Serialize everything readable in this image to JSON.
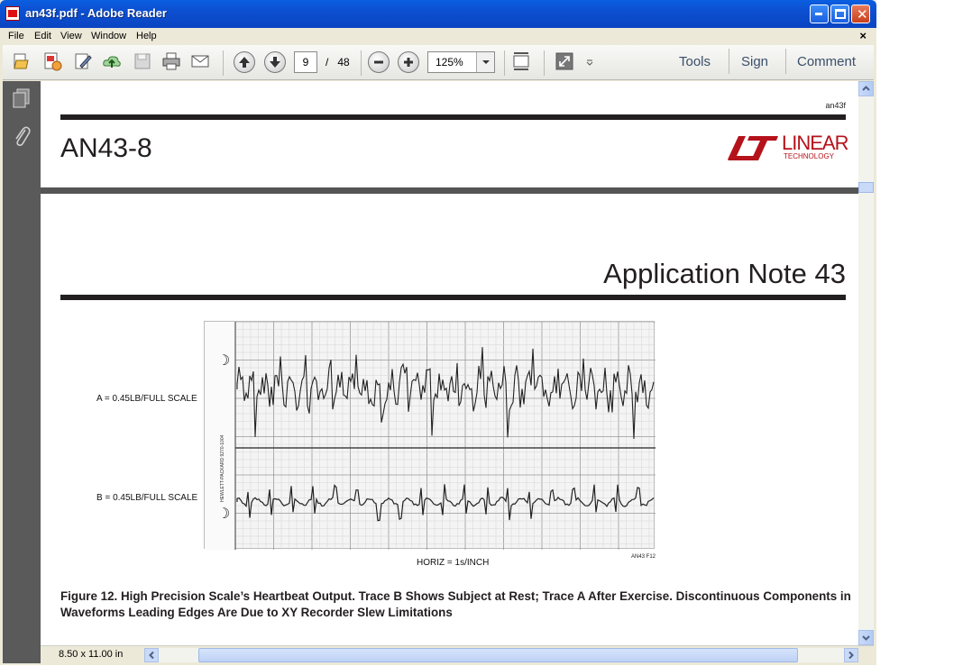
{
  "window": {
    "title": "an43f.pdf - Adobe Reader",
    "buttons": [
      "minimize",
      "maximize",
      "close"
    ]
  },
  "menu": {
    "items": [
      "File",
      "Edit",
      "View",
      "Window",
      "Help"
    ],
    "close_glyph": "×"
  },
  "toolbar": {
    "page_current": "9",
    "page_sep": "/",
    "page_total": "48",
    "zoom": "125%",
    "links": [
      "Tools",
      "Sign",
      "Comment"
    ]
  },
  "document": {
    "header_small": "an43f",
    "doc_code": "AN43-8",
    "logo_text": "LINEAR",
    "logo_sub": "TECHNOLOGY",
    "page_title": "Application Note 43",
    "figure": {
      "label_a": "A = 0.45LB/FULL SCALE",
      "label_b": "B = 0.45LB/FULL SCALE",
      "vertical_text": "HEWLETT-PACKARD   9270-1004",
      "horiz": "HORIZ = 1s/INCH",
      "figure_id": "AN43 F12"
    },
    "caption": "Figure 12. High Precision Scale’s Heartbeat Output. Trace B Shows Subject at Rest; Trace A After Exercise. Discontinuous Components in Waveforms Leading Edges Are Due to XY Recorder Slew Limitations"
  },
  "status": {
    "page_size": "8.50 x 11.00 in"
  },
  "colors": {
    "titlebar": "#0a5fe0",
    "logo": "#b5121b",
    "panel": "#5a5a5a"
  }
}
